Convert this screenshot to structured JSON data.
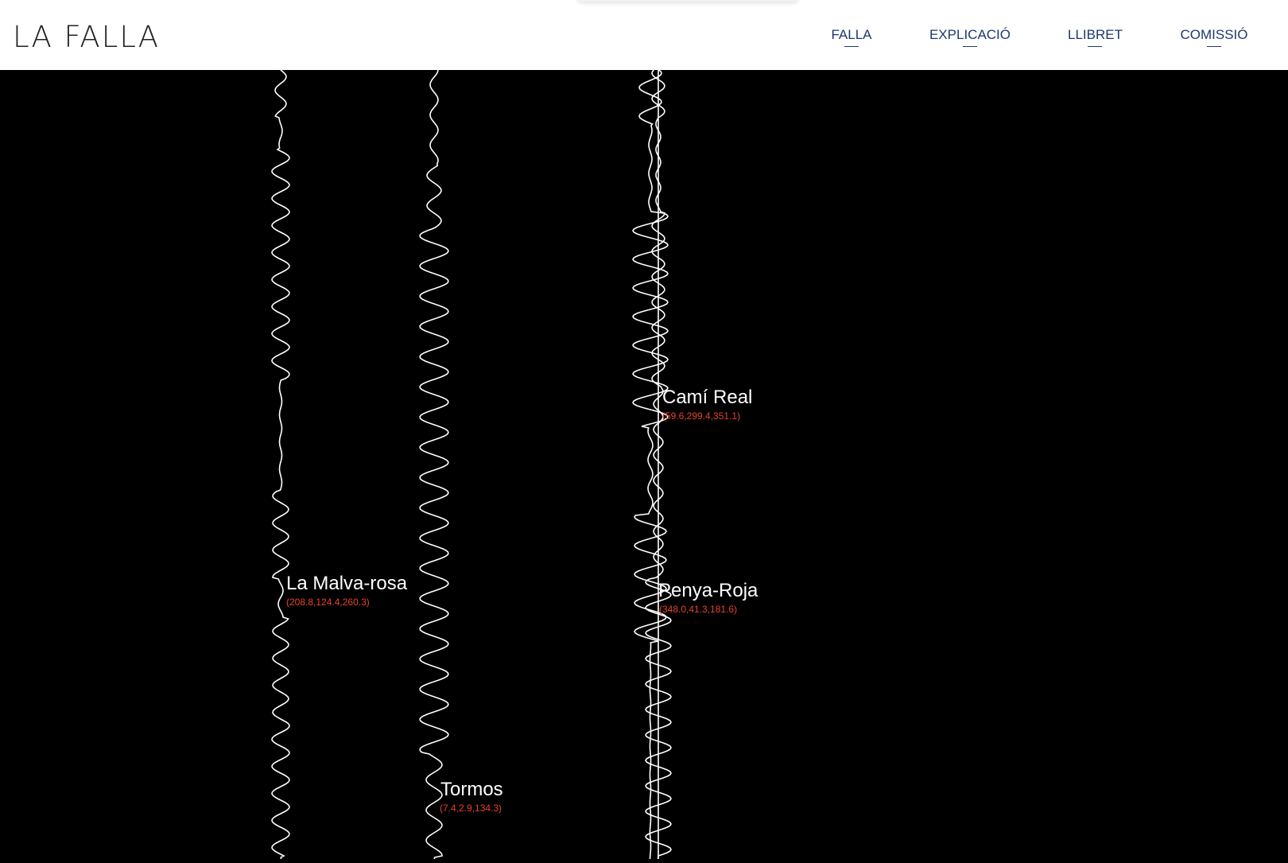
{
  "header": {
    "logo": "LA FALLA",
    "nav": [
      {
        "label": "FALLA"
      },
      {
        "label": "EXPLICACIÓ"
      },
      {
        "label": "LLIBRET"
      },
      {
        "label": "COMISSIÓ"
      }
    ]
  },
  "places": [
    {
      "name": "Camí Real",
      "coords": "(59.6,299.4,351.1)"
    },
    {
      "name": "La Malva-rosa",
      "coords": "(208.8,124.4,260.3)"
    },
    {
      "name": "Penya-Roja",
      "coords": "(348.0,41.3,181.6)"
    },
    {
      "name": "Tormos",
      "coords": "(7.4,2.9,134.3)"
    }
  ],
  "colors": {
    "background": "#000000",
    "header_bg": "#ffffff",
    "nav_text": "#1d3a6b",
    "coords_text": "#e6432a",
    "line": "#ffffff"
  }
}
